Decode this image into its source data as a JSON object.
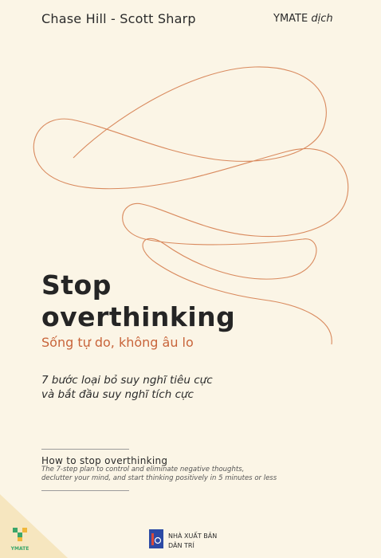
{
  "cover": {
    "authors": "Chase Hill - Scott Sharp",
    "translator_name": "YMATE",
    "translator_suffix": "dịch",
    "title_line1": "Stop",
    "title_line2": "overthinking",
    "subtitle": "Sống tự do, không âu lo",
    "tagline_line1": "7 bước loại bỏ suy nghĩ tiêu cực",
    "tagline_line2": "và bắt đầu suy nghĩ tích cực",
    "en_title": "How to stop overthinking",
    "en_desc_line1": "The 7-step plan to control and eliminate negative thoughts,",
    "en_desc_line2": "declutter your mind, and start thinking positively in 5 minutes or less"
  },
  "logos": {
    "ymate_label": "YMATE",
    "publisher_line1": "NHÀ XUẤT BẢN",
    "publisher_line2": "DÂN TRÍ"
  },
  "colors": {
    "background": "#fbf5e6",
    "accent": "#c8643a",
    "publisher_blue": "#2b4aa5",
    "ymate_green": "#3aa66a"
  }
}
